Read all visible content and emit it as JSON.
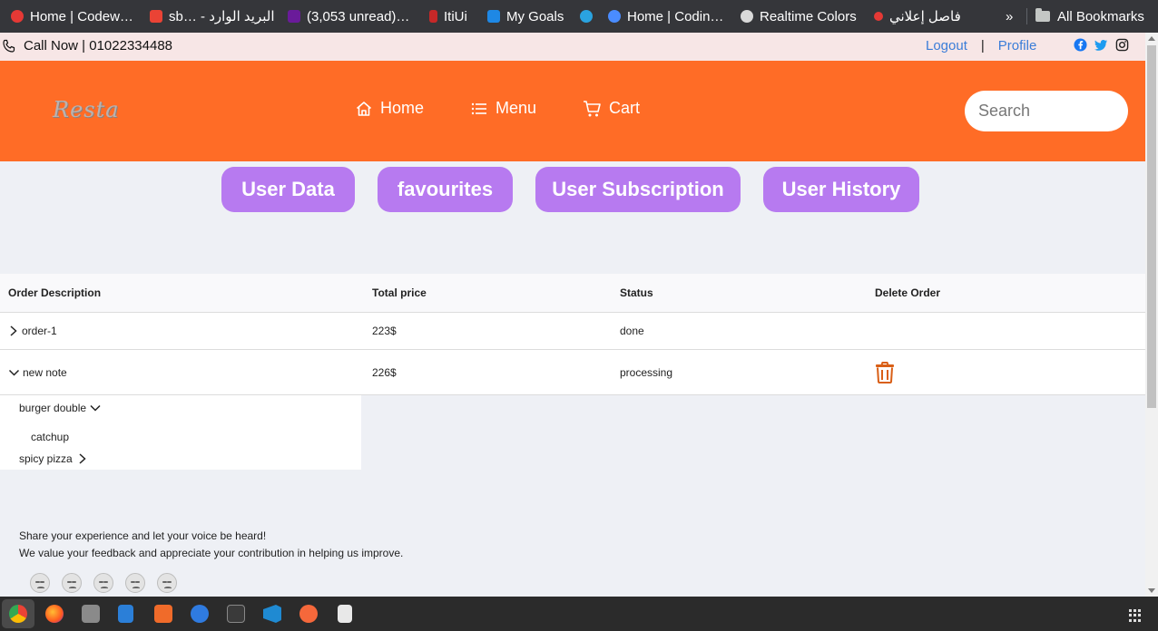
{
  "bookmarks": [
    {
      "label": "Home | Codew…",
      "color": "#e53935"
    },
    {
      "label": "sb… - البريد الوارد",
      "color": "#ea4335"
    },
    {
      "label": "(3,053 unread)…",
      "color": "#6a1b9a"
    },
    {
      "label": "ItiUi",
      "color": "#c62828"
    },
    {
      "label": "My Goals",
      "color": "#1e88e5"
    },
    {
      "label": "",
      "color": "#2aa3e0"
    },
    {
      "label": "Home | Codin…",
      "color": "#4a8cff"
    },
    {
      "label": "Realtime Colors",
      "color": "#d9d9d9"
    },
    {
      "label": "فاصل إعلاني",
      "color": "#e53935"
    }
  ],
  "bookmarks_overflow": "»",
  "all_bookmarks": "All Bookmarks",
  "topbar": {
    "phone": "Call Now | 01022334488",
    "logout": "Logout",
    "separator": "|",
    "profile": "Profile",
    "social_icons": [
      "facebook-icon",
      "twitter-icon",
      "instagram-icon"
    ]
  },
  "header": {
    "logo": "Resta",
    "nav": [
      {
        "label": "Home",
        "icon": "home-icon"
      },
      {
        "label": "Menu",
        "icon": "list-icon"
      },
      {
        "label": "Cart",
        "icon": "cart-icon"
      }
    ],
    "search_placeholder": "Search",
    "bg_color": "#ff6c26"
  },
  "tabs": [
    "User Data",
    "favourites",
    "User Subscription",
    "User History"
  ],
  "tab_color": "#b77af0",
  "table": {
    "headers": [
      "Order Description",
      "Total price",
      "Status",
      "Delete Order"
    ],
    "rows": [
      {
        "description": "order-1",
        "total": "223$",
        "status": "done",
        "expanded": false
      },
      {
        "description": "new note",
        "total": "226$",
        "status": "processing",
        "expanded": true
      }
    ],
    "sub_items": [
      {
        "label": "burger double",
        "expanded": true
      },
      {
        "label": "catchup"
      },
      {
        "label": "spicy pizza",
        "expanded": false
      }
    ]
  },
  "feedback": {
    "line1": "Share your experience and let your voice be heard!",
    "line2": "We value your feedback and appreciate your contribution in helping us improve.",
    "rating_count": 5
  }
}
